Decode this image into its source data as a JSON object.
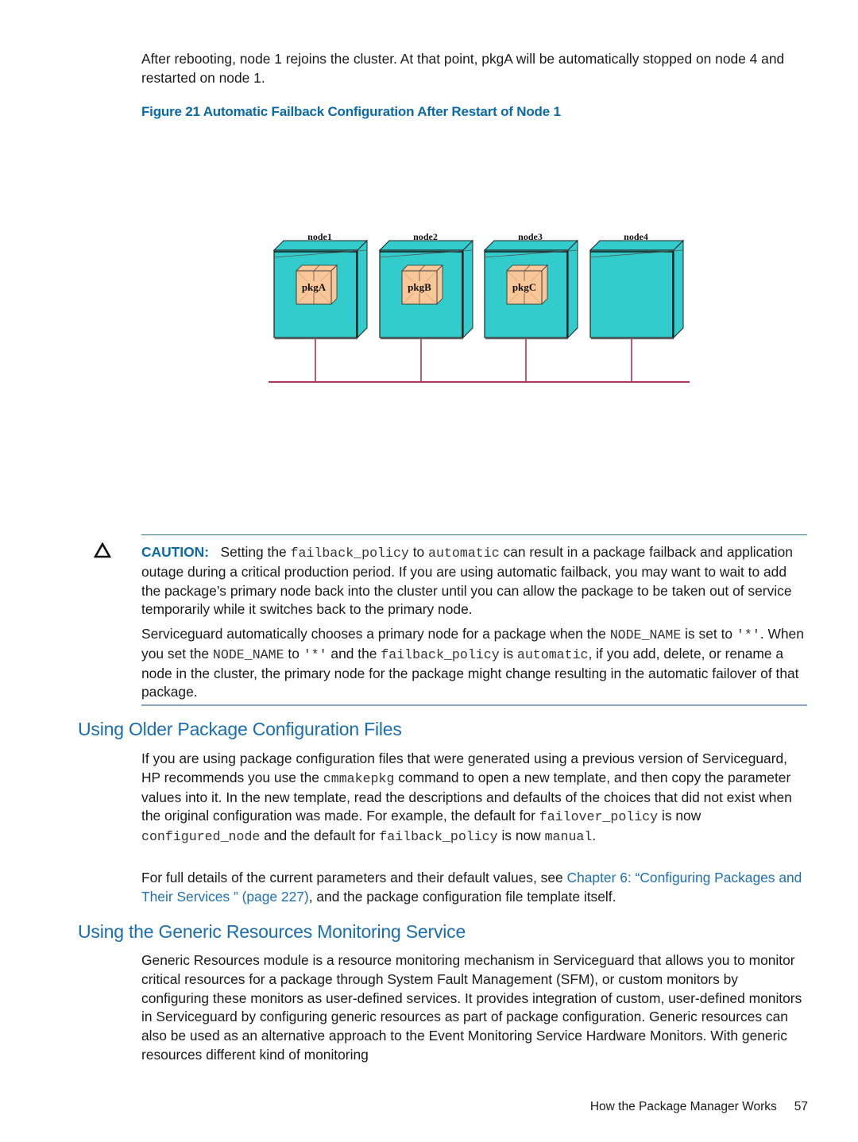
{
  "intro": {
    "text": "After rebooting, node 1 rejoins the cluster. At that point, pkgA will be automatically stopped on node 4 and restarted on node 1."
  },
  "figure": {
    "label": "Figure 21",
    "title": "Automatic Failback Configuration After Restart of Node 1",
    "nodes": [
      {
        "name": "node1",
        "package": "pkgA"
      },
      {
        "name": "node2",
        "package": "pkgB"
      },
      {
        "name": "node3",
        "package": "pkgC"
      },
      {
        "name": "node4",
        "package": null
      }
    ],
    "colors": {
      "node_fill": "#33cccc",
      "package_fill": "#f9c797",
      "network_line": "#b03060"
    }
  },
  "caution": {
    "icon": "warning-triangle-icon",
    "label": "CAUTION:",
    "p1_a": "Setting the ",
    "p1_code1": "failback_policy",
    "p1_b": " to ",
    "p1_code2": "automatic",
    "p1_c": " can result in a package failback and application outage during a critical production period. If you are using automatic failback, you may want to wait to add the package’s primary node back into the cluster until you can allow the package to be taken out of service temporarily while it switches back to the primary node.",
    "p2_a": "Serviceguard automatically chooses a primary node for a package when the ",
    "p2_code1": "NODE_NAME",
    "p2_b": " is set to ",
    "p2_code2": "'*'",
    "p2_c": ". When you set the ",
    "p2_code3": "NODE_NAME",
    "p2_d": " to ",
    "p2_code4": "'*'",
    "p2_e": " and the ",
    "p2_code5": "failback_policy",
    "p2_f": " is ",
    "p2_code6": "automatic",
    "p2_g": ", if you add, delete, or rename a node in the cluster, the primary node for the package might change resulting in the automatic failover of that package."
  },
  "section1": {
    "heading": "Using Older Package Configuration Files",
    "p1_a": "If you are using package configuration files that were generated using a previous version of Serviceguard, HP recommends you use the ",
    "p1_code1": "cmmakepkg",
    "p1_b": " command to open a new template, and then copy the parameter values into it. In the new template, read the descriptions and defaults of the choices that did not exist when the original configuration was made. For example, the default for ",
    "p1_code2": "failover_policy",
    "p1_c": " is now ",
    "p1_code3": "configured_node",
    "p1_d": " and the default for ",
    "p1_code4": "failback_policy",
    "p1_e": " is now ",
    "p1_code5": "manual",
    "p1_f": ".",
    "p2_a": "For full details of the current parameters and their default values, see ",
    "p2_link": "Chapter 6: “Configuring Packages and Their Services ” (page 227)",
    "p2_b": ", and the package configuration file template itself."
  },
  "section2": {
    "heading": "Using the Generic Resources Monitoring Service",
    "p1": "Generic Resources module is a resource monitoring mechanism in Serviceguard that allows you to monitor critical resources for a package through System Fault Management (SFM), or custom monitors by configuring these monitors as user-defined services. It provides integration of custom, user-defined monitors in Serviceguard by configuring generic resources as part of package configuration. Generic resources can also be used as an alternative approach to the Event Monitoring Service Hardware Monitors. With generic resources different kind of monitoring"
  },
  "footer": {
    "section": "How the Package Manager Works",
    "page": "57"
  }
}
